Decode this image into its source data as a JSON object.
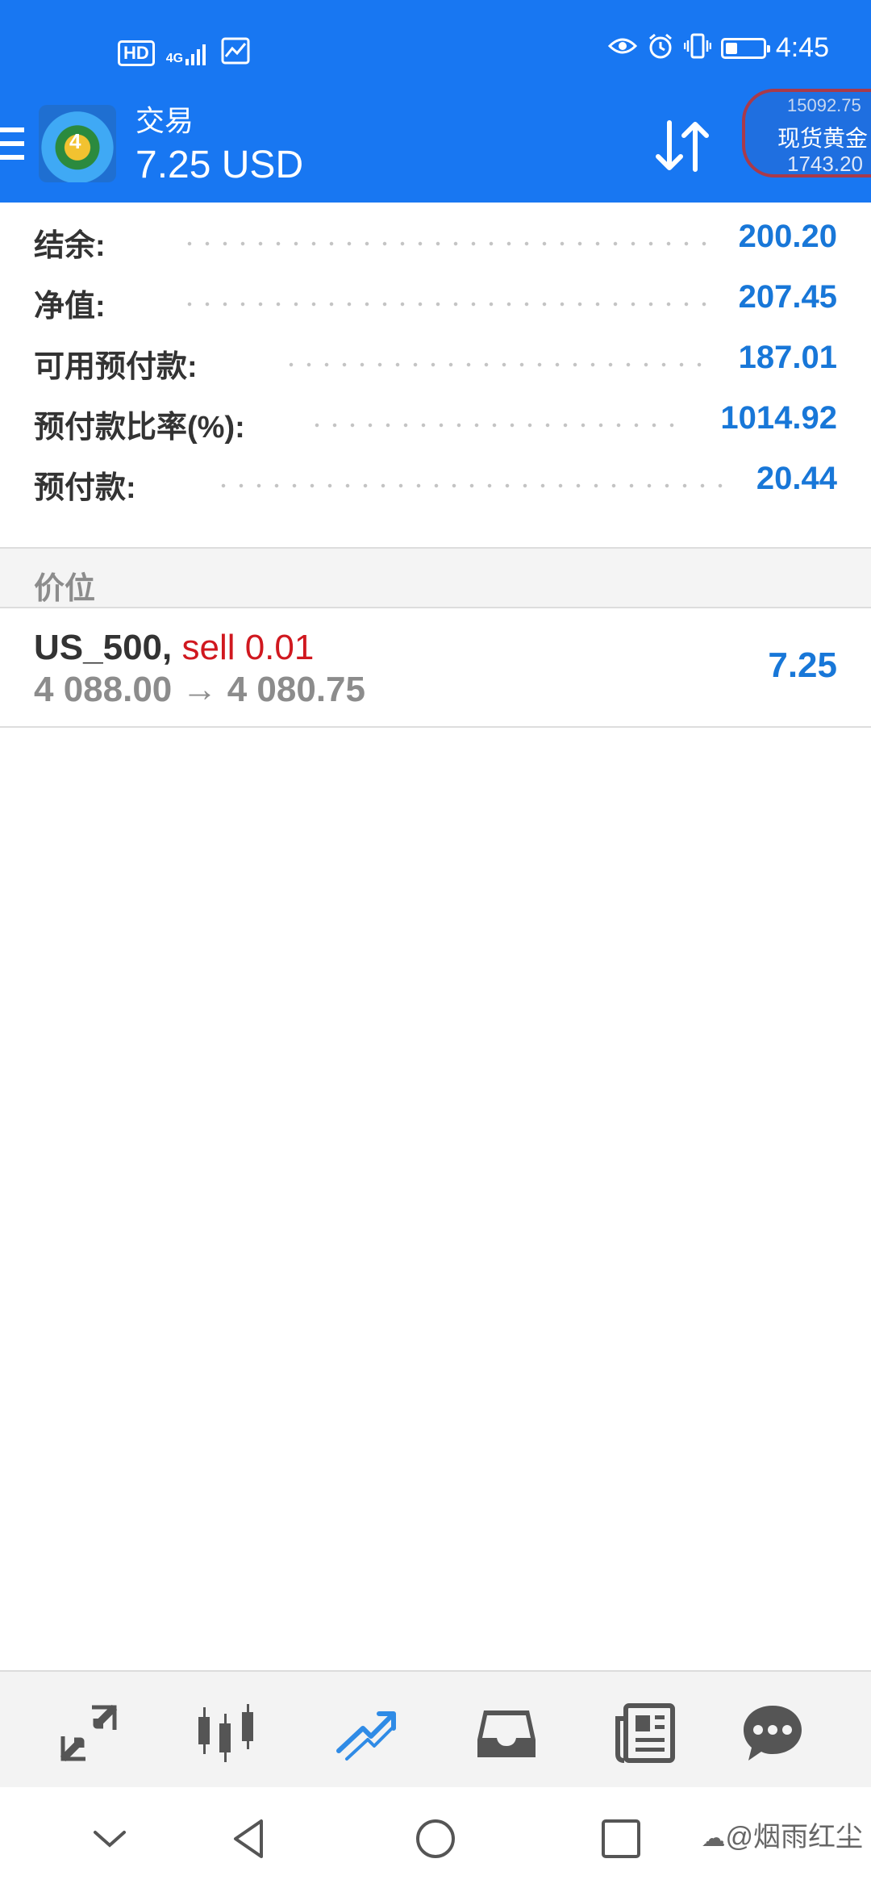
{
  "status_bar": {
    "hd_label": "HD",
    "network": "4G",
    "time": "4:45",
    "battery_percent": 30,
    "icons": [
      "hd-icon",
      "signal-icon",
      "app-notification-icon",
      "eye-icon",
      "alarm-icon",
      "vibrate-icon",
      "battery-icon"
    ]
  },
  "app_bar": {
    "title": "交易",
    "balance": "7.25 USD",
    "ticker": {
      "top": "15092.75",
      "name": "现货黄金",
      "price": "1743.20"
    }
  },
  "summary": [
    {
      "label": "结余:",
      "value": "200.20"
    },
    {
      "label": "净值:",
      "value": "207.45"
    },
    {
      "label": "可用预付款:",
      "value": "187.01"
    },
    {
      "label": "预付款比率(%):",
      "value": "1014.92"
    },
    {
      "label": "预付款:",
      "value": "20.44"
    }
  ],
  "section_header": "价位",
  "position": {
    "symbol": "US_500,",
    "side": "sell 0.01",
    "prices": "4 088.00 → 4 080.75",
    "profit": "7.25"
  },
  "bottom_nav": {
    "items": [
      "quotes-icon",
      "chart-icon",
      "trade-icon",
      "history-icon",
      "news-icon",
      "chat-icon"
    ],
    "active": "trade-icon",
    "active_color": "#2f8be6",
    "inactive_color": "#555555"
  },
  "system_nav": {
    "watermark": "@烟雨红尘"
  },
  "colors": {
    "primary": "#1877f2",
    "value_blue": "#1877d8",
    "sell_red": "#d0181f"
  }
}
